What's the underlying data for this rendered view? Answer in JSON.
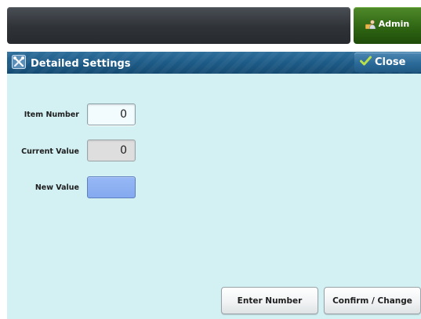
{
  "header": {
    "admin_label": "Admin",
    "admin_icon": "admin-user-icon"
  },
  "title_bar": {
    "title": "Detailed Settings",
    "title_icon": "tools-icon",
    "close_label": "Close",
    "close_icon": "checkmark-icon"
  },
  "fields": {
    "item_number": {
      "label": "Item Number",
      "value": "0"
    },
    "current_value": {
      "label": "Current Value",
      "value": "0"
    },
    "new_value": {
      "label": "New Value",
      "value": ""
    }
  },
  "buttons": {
    "enter_number": "Enter Number",
    "confirm_change": "Confirm / Change"
  },
  "colors": {
    "title_bar": "#1d5b87",
    "admin_button": "#2d6312",
    "content_background": "#d3f0f3",
    "new_value_field": "#8eb1f2"
  }
}
